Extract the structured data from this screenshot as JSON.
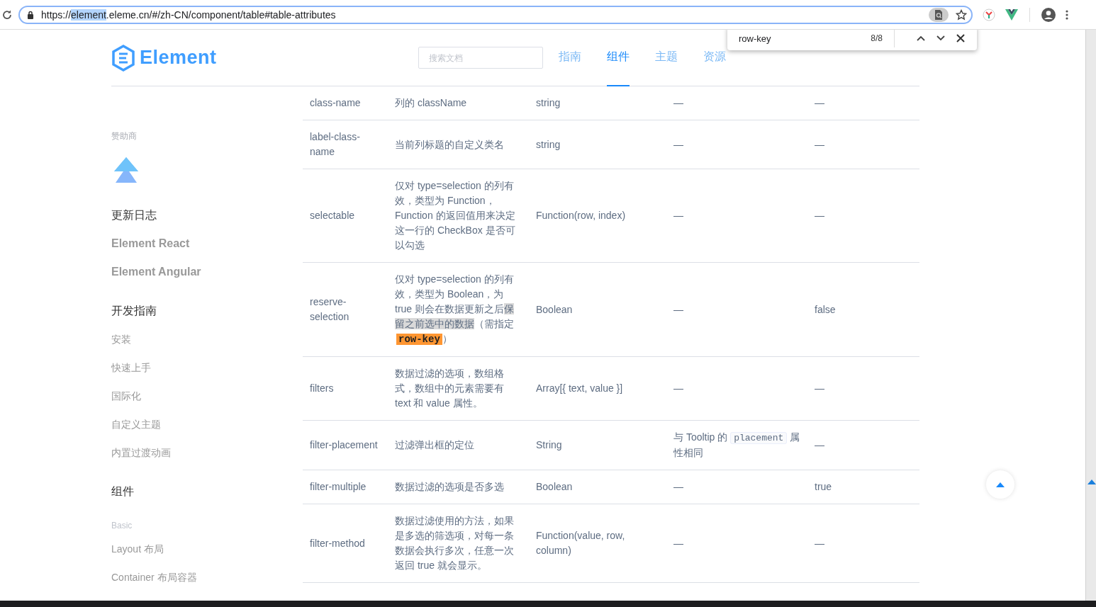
{
  "browser": {
    "url": [
      {
        "kind": "plain",
        "text": "https://"
      },
      {
        "kind": "selected",
        "text": "element"
      },
      {
        "kind": "plain",
        "text": ".eleme.cn/#/zh-CN/component/table#table-attributes"
      }
    ]
  },
  "find_bar": {
    "query": "row-key",
    "count": "8/8"
  },
  "header": {
    "logo": "Element",
    "search": {
      "placeholder": "搜索文档"
    },
    "nav": [
      {
        "label": "指南",
        "selected": false
      },
      {
        "label": "组件",
        "selected": true
      },
      {
        "label": "主题",
        "selected": false
      },
      {
        "label": "资源",
        "selected": false
      }
    ]
  },
  "sidebar": {
    "sponsor_label": "赞助商",
    "items": [
      {
        "kind": "heading",
        "label": "更新日志"
      },
      {
        "kind": "link-bold",
        "label": "Element React"
      },
      {
        "kind": "link-bold",
        "label": "Element Angular"
      },
      {
        "kind": "heading",
        "label": "开发指南"
      },
      {
        "kind": "link",
        "label": "安装"
      },
      {
        "kind": "link",
        "label": "快速上手"
      },
      {
        "kind": "link",
        "label": "国际化"
      },
      {
        "kind": "link",
        "label": "自定义主题"
      },
      {
        "kind": "link",
        "label": "内置过渡动画"
      },
      {
        "kind": "heading",
        "label": "组件"
      },
      {
        "kind": "group",
        "label": "Basic"
      },
      {
        "kind": "link",
        "label": "Layout 布局"
      },
      {
        "kind": "link",
        "label": "Container 布局容器"
      }
    ]
  },
  "table": {
    "rows": [
      {
        "param": "class-name",
        "desc": [
          {
            "kind": "plain",
            "text": "列的 className"
          }
        ],
        "type": "string",
        "optional": [
          {
            "kind": "plain",
            "text": "—"
          }
        ],
        "default": "—"
      },
      {
        "param": "label-class-name",
        "desc": [
          {
            "kind": "plain",
            "text": "当前列标题的自定义类名"
          }
        ],
        "type": "string",
        "optional": [
          {
            "kind": "plain",
            "text": "—"
          }
        ],
        "default": "—"
      },
      {
        "param": "selectable",
        "desc": [
          {
            "kind": "plain",
            "text": "仅对 type=selection 的列有效，类型为 Function，Function 的返回值用来决定这一行的 CheckBox 是否可以勾选"
          }
        ],
        "type": "Function(row, index)",
        "optional": [
          {
            "kind": "plain",
            "text": "—"
          }
        ],
        "default": "—"
      },
      {
        "param": "reserve-selection",
        "desc": [
          {
            "kind": "plain",
            "text": "仅对 type=selection 的列有效，类型为 Boolean，为 true 则会在数据更新之后"
          },
          {
            "kind": "highlight",
            "text": "保留之前选中的数据"
          },
          {
            "kind": "plain",
            "text": "（需指定 "
          },
          {
            "kind": "match",
            "text": "row-key"
          },
          {
            "kind": "plain",
            "text": "）"
          }
        ],
        "type": "Boolean",
        "optional": [
          {
            "kind": "plain",
            "text": "—"
          }
        ],
        "default": "false"
      },
      {
        "param": "filters",
        "desc": [
          {
            "kind": "plain",
            "text": "数据过滤的选项，数组格式，数组中的元素需要有 text 和 value 属性。"
          }
        ],
        "type": "Array[{ text, value }]",
        "optional": [
          {
            "kind": "plain",
            "text": "—"
          }
        ],
        "default": "—"
      },
      {
        "param": "filter-placement",
        "desc": [
          {
            "kind": "plain",
            "text": "过滤弹出框的定位"
          }
        ],
        "type": "String",
        "optional": [
          {
            "kind": "plain",
            "text": "与 Tooltip 的 "
          },
          {
            "kind": "code",
            "text": "placement"
          },
          {
            "kind": "plain",
            "text": " 属性相同"
          }
        ],
        "default": "—"
      },
      {
        "param": "filter-multiple",
        "desc": [
          {
            "kind": "plain",
            "text": "数据过滤的选项是否多选"
          }
        ],
        "type": "Boolean",
        "optional": [
          {
            "kind": "plain",
            "text": "—"
          }
        ],
        "default": "true"
      },
      {
        "param": "filter-method",
        "desc": [
          {
            "kind": "plain",
            "text": "数据过滤使用的方法，如果是多选的筛选项，对每一条数据会执行多次，任意一次返回 true 就会显示。"
          }
        ],
        "type": "Function(value, row, column)",
        "optional": [
          {
            "kind": "plain",
            "text": "—"
          }
        ],
        "default": "—"
      }
    ]
  }
}
